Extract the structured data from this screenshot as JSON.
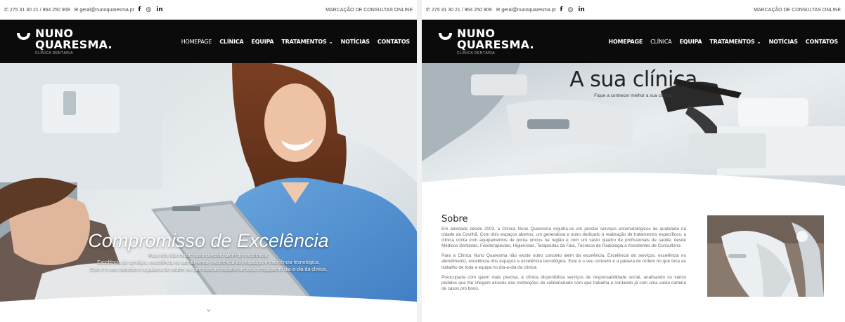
{
  "topbar": {
    "phone": "275 31 30 21 / 964 250 909",
    "email": "geral@nunoquaresma.pt",
    "social": [
      "f",
      "◎",
      "in"
    ],
    "booking": "MARCAÇÃO DE CONSULTAS ONLINE"
  },
  "logo": {
    "line1": "NUNO",
    "line2": "QUARESMA.",
    "tagline": "CLÍNICA DENTÁRIA"
  },
  "nav": {
    "homepage": "HOMEPAGE",
    "clinica": "CLÍNICA",
    "equipa": "EQUIPA",
    "tratamentos": "TRATAMENTOS ⌄",
    "noticias": "NOTÍCIAS",
    "contatos": "CONTATOS"
  },
  "hero": {
    "title": "Compromisso de Excelência",
    "line1": "Para nós não existe outro conceito além da excelência.",
    "line2": "Excelência de serviços, excelência no atendimento, excelência dos espaços e excelência tecnológica.",
    "line3": "Este é o seu conceito e a palavra de ordem no que toca ao trabalho de toda a equipa no dia-a-dia da clínica.",
    "scroll_icon": "⌄"
  },
  "clinic_hero": {
    "title": "A sua clínica",
    "subtitle": "Fique a conhecer melhor a sua clínica."
  },
  "about": {
    "title": "Sobre",
    "p1": "Em atividade desde 2003, a Clínica Nuno Quaresma orgulha-se em prestar serviços estomatológicos de qualidade na cidade da Covilhã. Com dois espaços abertos, um generalista e outro dedicado à realização de tratamentos específicos, a clínica conta com equipamentos de ponta únicos na região e com um vasto quadro de profissionais de saúde, desde Médicos Dentistas, Fisioterapeutas, Higienistas, Terapeutas da Fala, Técnicos de Radiologia a Assistentes de Consultório.",
    "p2": "Para a Clínica Nuno Quaresma não existe outro conceito além da excelência. Excelência de serviços, excelência no atendimento, excelência dos espaços e excelência tecnológica. Este é o seu conceito e a palavra de ordem no que toca ao trabalho de toda a equipa no dia-a-dia da clínica.",
    "p3": "Preocupada com quem mais precisa, a clínica disponibiliza serviços de responsabilidade social, analisando os vários pedidos que lhe chegam através das instituições de solidariedade com que trabalha e contando já com uma vasta carteira de casos pro bono."
  },
  "icons": {
    "phone": "phone-icon",
    "email": "envelope-icon",
    "scroll": "chevron-down-icon"
  }
}
